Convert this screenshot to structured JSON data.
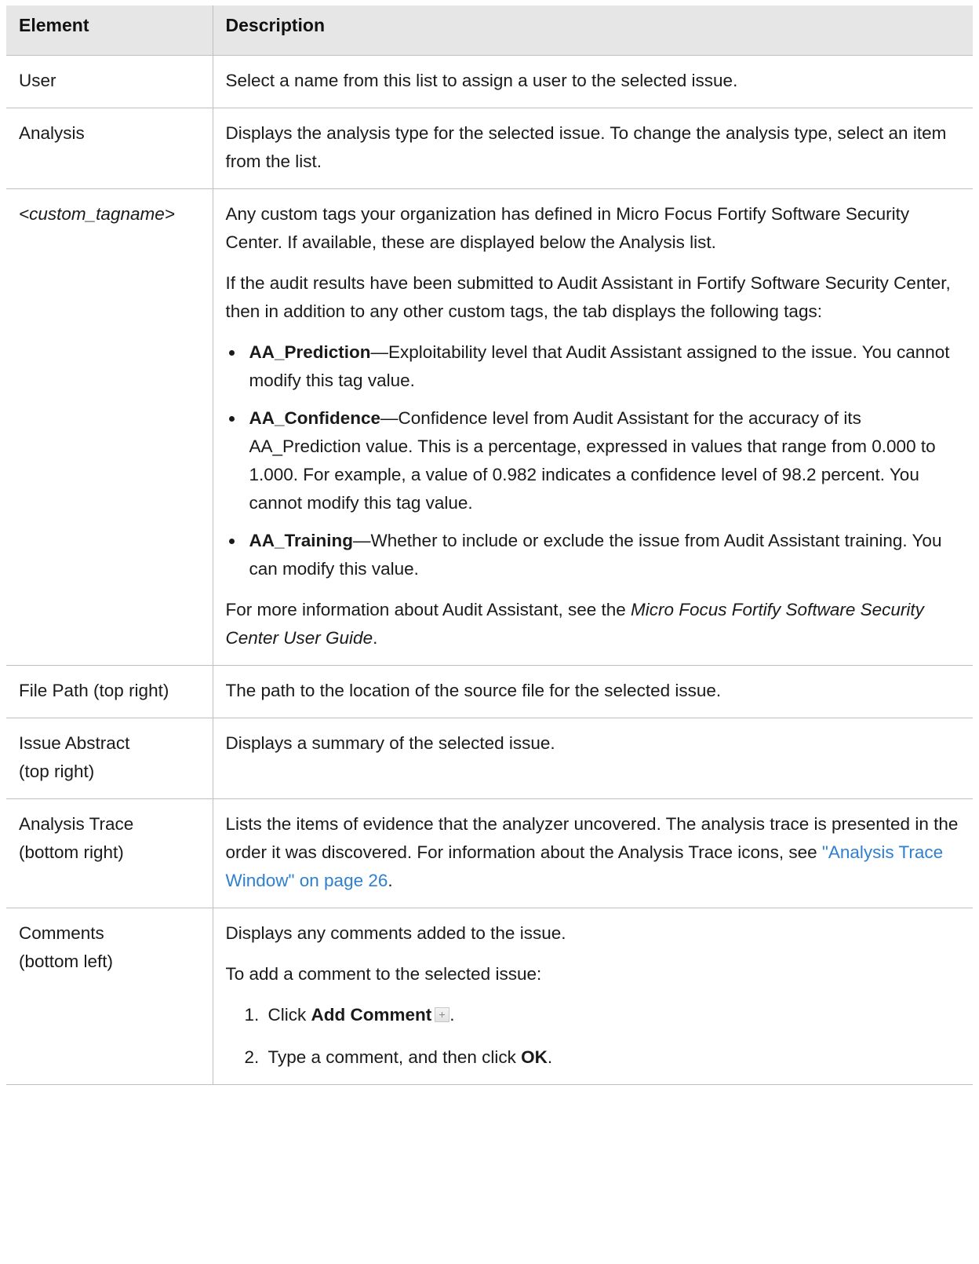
{
  "headers": {
    "element": "Element",
    "description": "Description"
  },
  "rows": {
    "user": {
      "element": "User",
      "description": "Select a name from this list to assign a user to the selected issue."
    },
    "analysis": {
      "element": "Analysis",
      "description": "Displays the analysis type for the selected issue. To change the analysis type, select an item from the list."
    },
    "custom_tag": {
      "element": "<custom_tagname>",
      "p1": "Any custom tags your organization has defined in Micro Focus Fortify Software Security Center. If available, these are displayed below the Analysis list.",
      "p2": "If the audit results have been submitted to Audit Assistant in Fortify Software Security Center, then in addition to any other custom tags, the tab displays the following tags:",
      "bullets": [
        {
          "term": "AA_Prediction",
          "text": "—Exploitability level that Audit Assistant assigned to the issue. You cannot modify this tag value."
        },
        {
          "term": "AA_Confidence",
          "text": "—Confidence level from Audit Assistant for the accuracy of its AA_Prediction value. This is a percentage, expressed in values that range from 0.000 to 1.000. For example, a value of 0.982 indicates a confidence level of 98.2 percent. You cannot modify this tag value."
        },
        {
          "term": "AA_Training",
          "text": "—Whether to include or exclude the issue from Audit Assistant training. You can modify this value."
        }
      ],
      "p3_before": "For more information about Audit Assistant, see the ",
      "p3_italic": "Micro Focus Fortify Software Security Center User Guide",
      "p3_after": "."
    },
    "file_path": {
      "element": "File Path (top right)",
      "description": "The path to the location of the source file for the selected issue."
    },
    "issue_abstract": {
      "element_line1": "Issue Abstract",
      "element_line2": "(top right)",
      "description": "Displays a summary of the selected issue."
    },
    "analysis_trace": {
      "element_line1": "Analysis Trace",
      "element_line2": "(bottom right)",
      "description_before": "Lists the items of evidence that the analyzer uncovered. The analysis trace is presented in the order it was discovered. For information about the Analysis Trace icons, see ",
      "link": "\"Analysis Trace Window\" on page 26",
      "description_after": "."
    },
    "comments": {
      "element_line1": "Comments",
      "element_line2": "(bottom left)",
      "p1": "Displays any comments added to the issue.",
      "p2": "To add a comment to the selected issue:",
      "steps": [
        {
          "num": "1.",
          "before": "Click ",
          "bold": "Add Comment",
          "after": "."
        },
        {
          "num": "2.",
          "before": "Type a comment, and then click ",
          "bold": "OK",
          "after": "."
        }
      ]
    }
  },
  "icons": {
    "add_comment": "plus-icon"
  }
}
